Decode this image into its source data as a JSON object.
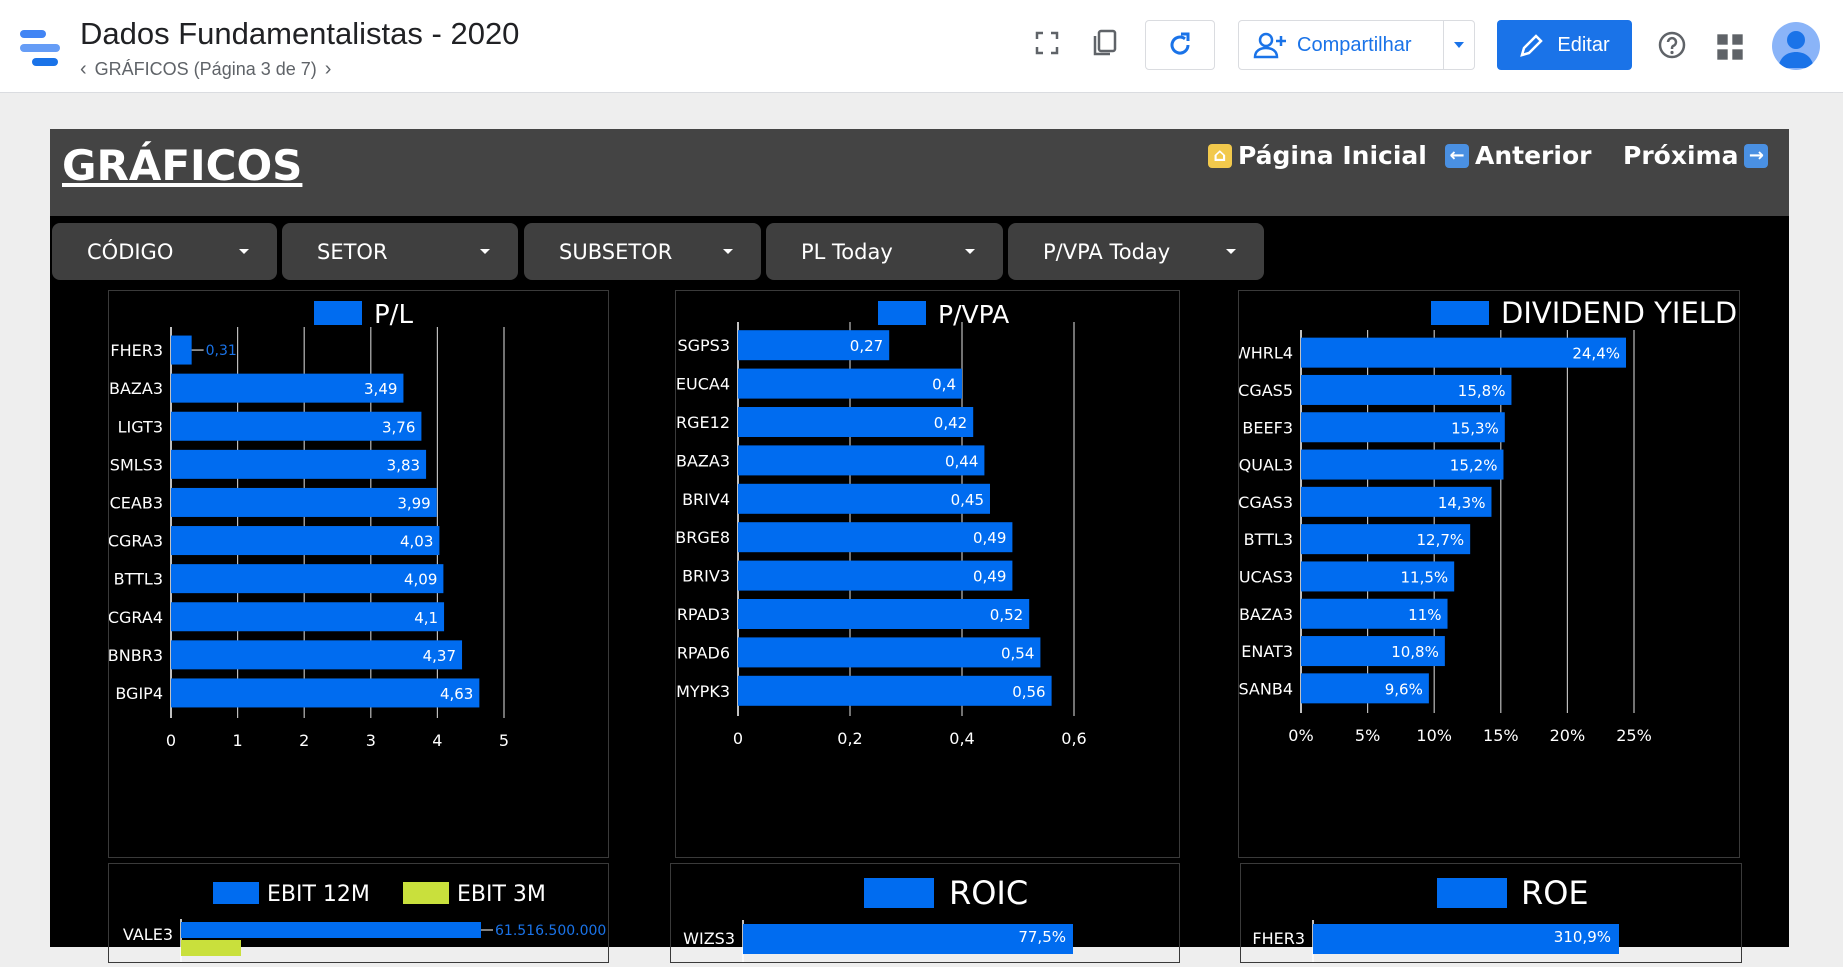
{
  "app": {
    "title": "Dados Fundamentalistas - 2020",
    "breadcrumb": "GRÁFICOS (Página 3 de 7)",
    "share_label": "Compartilhar",
    "edit_label": "Editar"
  },
  "report": {
    "title": "GRÁFICOS",
    "nav": {
      "home": "Página Inicial",
      "prev": "Anterior",
      "next": "Próxima"
    },
    "filters": [
      "CÓDIGO",
      "SETOR",
      "SUBSETOR",
      "PL Today",
      "P/VPA Today"
    ]
  },
  "colors": {
    "bar": "#006cf0",
    "bar_alt": "#c9e03c",
    "accent": "#1a73e8"
  },
  "chart_data": [
    {
      "type": "bar",
      "title": "P/L",
      "categories": [
        "FHER3",
        "BAZA3",
        "LIGT3",
        "SMLS3",
        "CEAB3",
        "CGRA3",
        "BTTL3",
        "CGRA4",
        "BNBR3",
        "BGIP4"
      ],
      "values": [
        0.31,
        3.49,
        3.76,
        3.83,
        3.99,
        4.03,
        4.09,
        4.1,
        4.37,
        4.63
      ],
      "labels": [
        "0,31",
        "3,49",
        "3,76",
        "3,83",
        "3,99",
        "4,03",
        "4,09",
        "4,1",
        "4,37",
        "4,63"
      ],
      "xlim": [
        0,
        5
      ],
      "ticks": [
        "0",
        "1",
        "2",
        "3",
        "4",
        "5"
      ],
      "tick_values": [
        0,
        1,
        2,
        3,
        4,
        5
      ]
    },
    {
      "type": "bar",
      "title": "P/VPA",
      "categories": [
        "SGPS3",
        "EUCA4",
        "BRGE12",
        "BAZA3",
        "BRIV4",
        "BRGE8",
        "BRIV3",
        "RPAD3",
        "RPAD6",
        "MYPK3"
      ],
      "values": [
        0.27,
        0.4,
        0.42,
        0.44,
        0.45,
        0.49,
        0.49,
        0.52,
        0.54,
        0.56
      ],
      "labels": [
        "0,27",
        "0,4",
        "0,42",
        "0,44",
        "0,45",
        "0,49",
        "0,49",
        "0,52",
        "0,54",
        "0,56"
      ],
      "xlim": [
        0,
        0.6
      ],
      "ticks": [
        "0",
        "0,2",
        "0,4",
        "0,6"
      ],
      "tick_values": [
        0,
        0.2,
        0.4,
        0.6
      ]
    },
    {
      "type": "bar",
      "title": "DIVIDEND YIELD",
      "categories": [
        "WHRL4",
        "CGAS5",
        "BEEF3",
        "QUAL3",
        "CGAS3",
        "BTTL3",
        "UCAS3",
        "BAZA3",
        "ENAT3",
        "SANB4"
      ],
      "values": [
        24.4,
        15.8,
        15.3,
        15.2,
        14.3,
        12.7,
        11.5,
        11,
        10.8,
        9.6
      ],
      "labels": [
        "24,4%",
        "15,8%",
        "15,3%",
        "15,2%",
        "14,3%",
        "12,7%",
        "11,5%",
        "11%",
        "10,8%",
        "9,6%"
      ],
      "xlim": [
        0,
        25
      ],
      "ticks": [
        "0%",
        "5%",
        "10%",
        "15%",
        "20%",
        "25%"
      ],
      "tick_values": [
        0,
        5,
        10,
        15,
        20,
        25
      ]
    },
    {
      "type": "bar",
      "series": [
        {
          "name": "EBIT 12M"
        },
        {
          "name": "EBIT 3M"
        }
      ],
      "categories": [
        "VALE3"
      ],
      "values": [
        61516500000
      ],
      "labels": [
        "61.516.500.000"
      ]
    },
    {
      "type": "bar",
      "title": "ROIC",
      "categories": [
        "WIZS3"
      ],
      "values": [
        77.5
      ],
      "labels": [
        "77,5%"
      ]
    },
    {
      "type": "bar",
      "title": "ROE",
      "categories": [
        "FHER3"
      ],
      "values": [
        310.9
      ],
      "labels": [
        "310,9%"
      ]
    }
  ]
}
